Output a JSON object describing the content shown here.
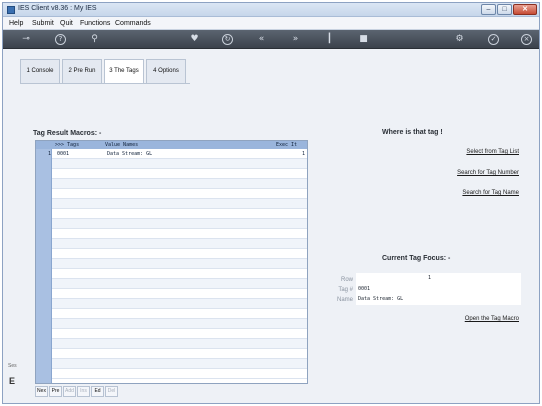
{
  "window": {
    "title": "IES Client v8.36 : My IES"
  },
  "menu": [
    {
      "label": "Help"
    },
    {
      "label": "Submit"
    },
    {
      "label": "Quit"
    },
    {
      "label": "Functions"
    },
    {
      "label": "Commands"
    }
  ],
  "tabs": [
    {
      "label": "1 Console"
    },
    {
      "label": "2 Pre Run"
    },
    {
      "label": "3 The Tags"
    },
    {
      "label": "4 Options"
    }
  ],
  "tag_macros": {
    "title": "Tag Result Macros: -",
    "columns": {
      "tags": ">>> Tags",
      "value": "Value Names",
      "exec": "Exec It"
    },
    "rows": [
      {
        "num": "1",
        "tag": "0001",
        "value": "Data Stream: GL",
        "exec": "1"
      }
    ]
  },
  "nav": [
    {
      "label": "Nex",
      "enabled": true
    },
    {
      "label": "Pre",
      "enabled": true
    },
    {
      "label": "Add",
      "enabled": false
    },
    {
      "label": "Ins",
      "enabled": false
    },
    {
      "label": "Ed",
      "enabled": true
    },
    {
      "label": "Del",
      "enabled": false
    }
  ],
  "where": {
    "title": "Where is that tag !",
    "links": [
      {
        "label": "Select from Tag List"
      },
      {
        "label": "Search for Tag Number"
      },
      {
        "label": "Search for Tag Name"
      }
    ]
  },
  "focus": {
    "title": "Current Tag Focus: -",
    "row_label": "Row",
    "row_value": "1",
    "tag_label": "Tag #",
    "tag_value": "0001",
    "name_label": "Name",
    "name_value": "Data Stream: GL",
    "open_link": "Open the Tag Macro"
  },
  "side": {
    "ses_label": "Ses",
    "ses_icon_text": "E"
  },
  "icons": {
    "toolbar": [
      "key-icon",
      "help-icon",
      "search-icon",
      "heart-icon",
      "refresh-icon",
      "rewind-icon",
      "fast-forward-icon",
      "pin-icon",
      "stop-icon",
      "gear-icon",
      "check-icon",
      "close-icon"
    ]
  },
  "colors": {
    "toolbar_bg": "#4a525d",
    "grid_header": "#9ab5dc",
    "gutter": "#a9c0e2"
  }
}
